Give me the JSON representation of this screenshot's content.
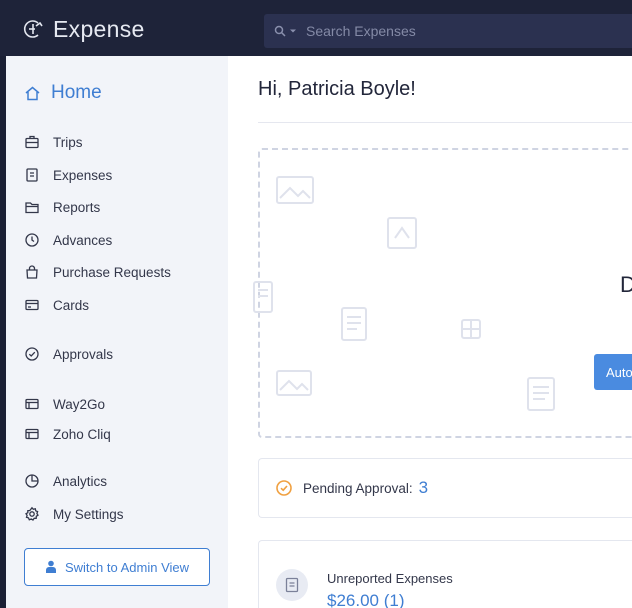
{
  "app": {
    "name": "Expense"
  },
  "search": {
    "placeholder": "Search Expenses",
    "filter_icon": "search-icon"
  },
  "sidebar": {
    "home": {
      "label": "Home",
      "icon": "home-icon"
    },
    "items": [
      {
        "label": "Trips",
        "icon": "briefcase-icon"
      },
      {
        "label": "Expenses",
        "icon": "receipt-icon"
      },
      {
        "label": "Reports",
        "icon": "folder-icon"
      },
      {
        "label": "Advances",
        "icon": "clock-icon"
      },
      {
        "label": "Purchase Requests",
        "icon": "bag-icon"
      },
      {
        "label": "Cards",
        "icon": "card-icon"
      },
      {
        "label": "Approvals",
        "icon": "check-circle-icon"
      },
      {
        "label": "Way2Go",
        "icon": "window-icon"
      },
      {
        "label": "Zoho Cliq",
        "icon": "window-icon"
      },
      {
        "label": "Analytics",
        "icon": "pie-chart-icon"
      },
      {
        "label": "My Settings",
        "icon": "gear-icon"
      }
    ],
    "admin_button": {
      "label": "Switch to Admin View",
      "icon": "person-icon"
    }
  },
  "main": {
    "greeting": "Hi, Patricia Boyle!",
    "dropzone": {
      "heading_visible": "D",
      "button_visible": "Auto"
    },
    "pending": {
      "label": "Pending Approval:",
      "count": "3"
    },
    "unreported": {
      "label": "Unreported Expenses",
      "amount": "$26.00 (1)"
    }
  },
  "colors": {
    "accent": "#3f7ed2",
    "topbar": "#1e2339",
    "sidebar": "#f2f4f9",
    "pending_icon": "#f0a040"
  }
}
